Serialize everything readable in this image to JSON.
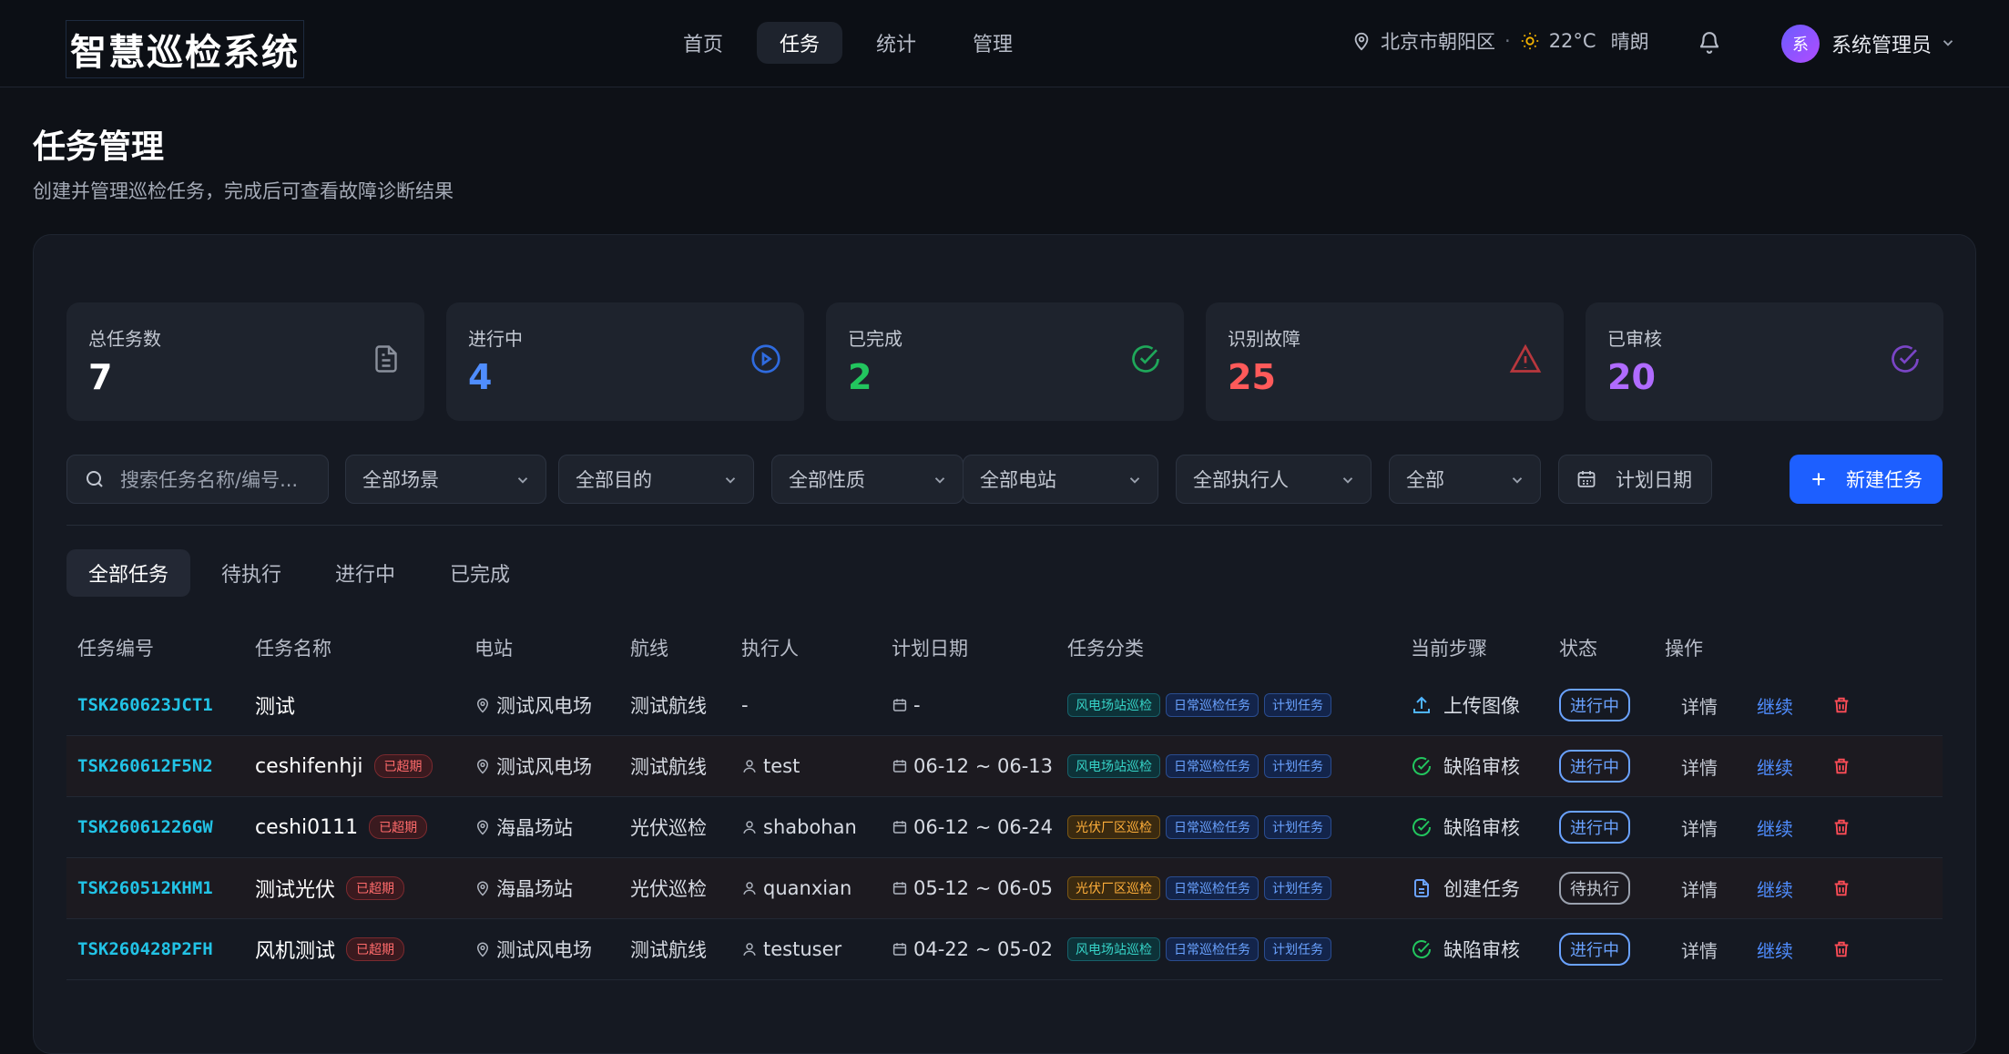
{
  "app": {
    "title": "智慧巡检系统"
  },
  "nav": {
    "items": [
      {
        "label": "首页",
        "active": false
      },
      {
        "label": "任务",
        "active": true
      },
      {
        "label": "统计",
        "active": false
      },
      {
        "label": "管理",
        "active": false
      }
    ]
  },
  "weather": {
    "location": "北京市朝阳区",
    "separator": "·",
    "temp": "22°C",
    "condition": "晴朗"
  },
  "user": {
    "avatar": "系",
    "name": "系统管理员"
  },
  "page": {
    "title": "任务管理",
    "subtitle": "创建并管理巡检任务，完成后可查看故障诊断结果"
  },
  "stats": [
    {
      "label": "总任务数",
      "value": "7",
      "color": "#ffffff",
      "icon": "document-icon"
    },
    {
      "label": "进行中",
      "value": "4",
      "color": "#4f8dff",
      "icon": "play-circle-icon"
    },
    {
      "label": "已完成",
      "value": "2",
      "color": "#22c55e",
      "icon": "check-circle-icon"
    },
    {
      "label": "识别故障",
      "value": "25",
      "color": "#ff5a5a",
      "icon": "warning-icon"
    },
    {
      "label": "已审核",
      "value": "20",
      "color": "#b06bff",
      "icon": "check-circle-icon"
    }
  ],
  "filters": {
    "search_placeholder": "搜索任务名称/编号...",
    "scene": "全部场景",
    "purpose": "全部目的",
    "nature": "全部性质",
    "station": "全部电站",
    "executor": "全部执行人",
    "status": "全部",
    "date": "计划日期",
    "new_button": "新建任务"
  },
  "tabs": [
    {
      "label": "全部任务",
      "active": true
    },
    {
      "label": "待执行",
      "active": false
    },
    {
      "label": "进行中",
      "active": false
    },
    {
      "label": "已完成",
      "active": false
    }
  ],
  "table": {
    "headers": [
      "任务编号",
      "任务名称",
      "电站",
      "航线",
      "执行人",
      "计划日期",
      "任务分类",
      "当前步骤",
      "状态",
      "操作"
    ],
    "rows": [
      {
        "code": "TSK260623JCT1",
        "name": "测试",
        "overdue": "",
        "station": "测试风电场",
        "route": "测试航线",
        "executor": "-",
        "date": "-",
        "chips": [
          [
            "风电场站巡检",
            "teal"
          ],
          [
            "日常巡检任务",
            "blue"
          ],
          [
            "计划任务",
            "blue"
          ]
        ],
        "step": "上传图像",
        "step_icon": "upload-icon",
        "status": "进行中",
        "status_type": "run",
        "detail": "详情",
        "action": "继续"
      },
      {
        "code": "TSK260612F5N2",
        "name": "ceshifenhji",
        "overdue": "已超期",
        "station": "测试风电场",
        "route": "测试航线",
        "executor": "test",
        "date": "06-12 ~ 06-13",
        "chips": [
          [
            "风电场站巡检",
            "teal"
          ],
          [
            "日常巡检任务",
            "blue"
          ],
          [
            "计划任务",
            "blue"
          ]
        ],
        "step": "缺陷审核",
        "step_icon": "check-circle-icon",
        "status": "进行中",
        "status_type": "run",
        "detail": "详情",
        "action": "继续"
      },
      {
        "code": "TSK26061226GW",
        "name": "ceshi0111",
        "overdue": "已超期",
        "station": "海晶场站",
        "route": "光伏巡检",
        "executor": "shabohan",
        "date": "06-12 ~ 06-24",
        "chips": [
          [
            "光伏厂区巡检",
            "orange"
          ],
          [
            "日常巡检任务",
            "blue"
          ],
          [
            "计划任务",
            "blue"
          ]
        ],
        "step": "缺陷审核",
        "step_icon": "check-circle-icon",
        "status": "进行中",
        "status_type": "run",
        "detail": "详情",
        "action": "继续"
      },
      {
        "code": "TSK260512KHM1",
        "name": "测试光伏",
        "overdue": "已超期",
        "station": "海晶场站",
        "route": "光伏巡检",
        "executor": "quanxian",
        "date": "05-12 ~ 06-05",
        "chips": [
          [
            "光伏厂区巡检",
            "orange"
          ],
          [
            "日常巡检任务",
            "blue"
          ],
          [
            "计划任务",
            "blue"
          ]
        ],
        "step": "创建任务",
        "step_icon": "document-icon",
        "status": "待执行",
        "status_type": "wait",
        "detail": "详情",
        "action": "继续"
      },
      {
        "code": "TSK260428P2FH",
        "name": "风机测试",
        "overdue": "已超期",
        "station": "测试风电场",
        "route": "测试航线",
        "executor": "testuser",
        "date": "04-22 ~ 05-02",
        "chips": [
          [
            "风电场站巡检",
            "teal"
          ],
          [
            "日常巡检任务",
            "blue"
          ],
          [
            "计划任务",
            "blue"
          ]
        ],
        "step": "缺陷审核",
        "step_icon": "check-circle-icon",
        "status": "进行中",
        "status_type": "run",
        "detail": "详情",
        "action": "继续"
      }
    ]
  }
}
